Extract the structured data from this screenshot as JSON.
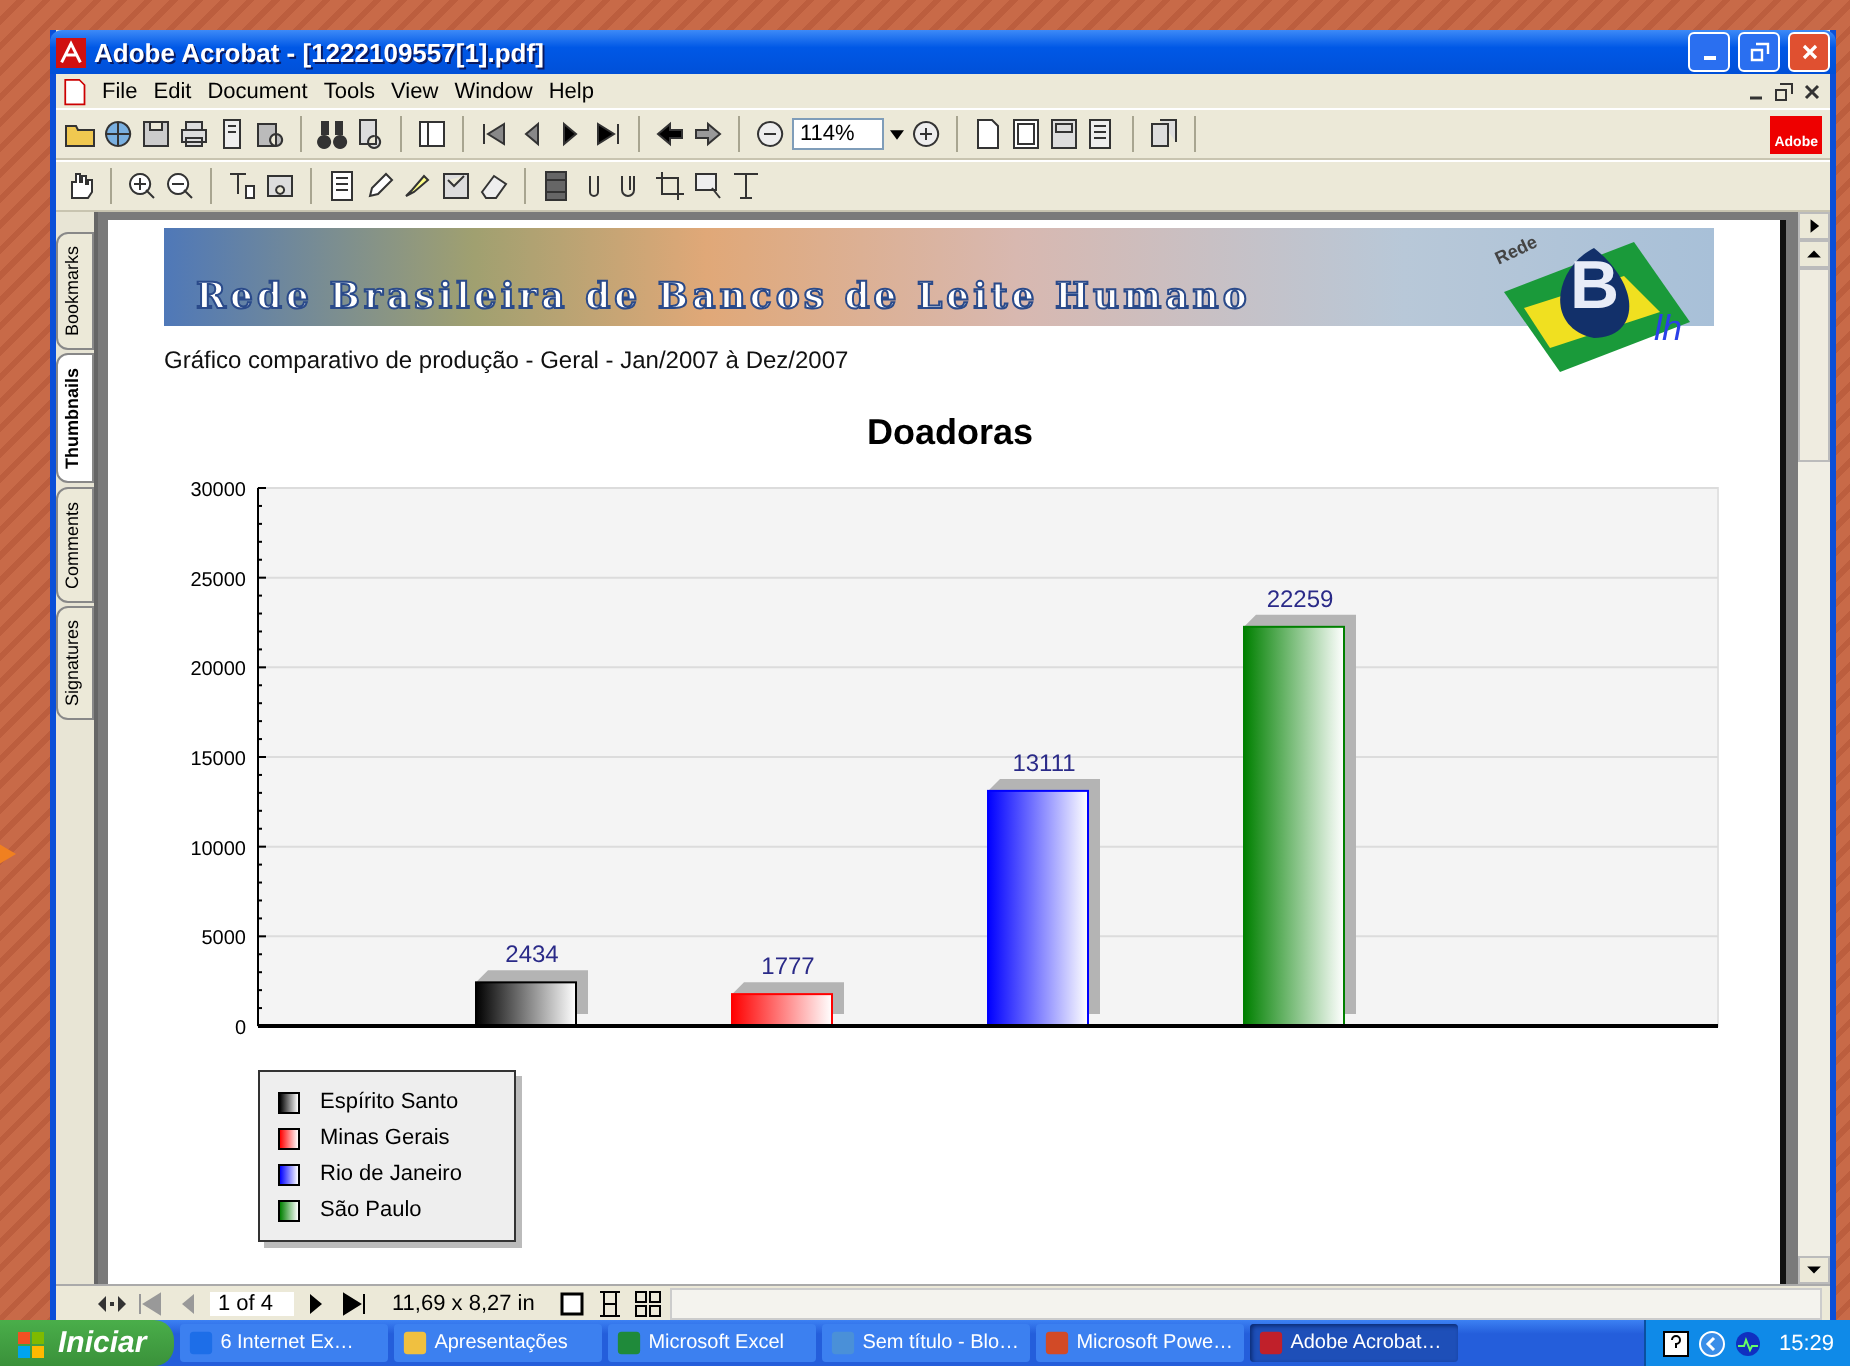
{
  "window": {
    "title": "Adobe Acrobat - [1222109557[1].pdf]"
  },
  "menu": [
    "File",
    "Edit",
    "Document",
    "Tools",
    "View",
    "Window",
    "Help"
  ],
  "toolbar": {
    "zoom": "114%",
    "logo": "Adobe"
  },
  "side_tabs": [
    {
      "label": "Bookmarks",
      "selected": false
    },
    {
      "label": "Thumbnails",
      "selected": true
    },
    {
      "label": "Comments",
      "selected": false
    },
    {
      "label": "Signatures",
      "selected": false
    }
  ],
  "document": {
    "banner": "Rede Brasileira de Bancos de Leite Humano",
    "logo_text": "Rede",
    "logo_letters": "B",
    "logo_sub": "lh",
    "subtitle": "Gráfico comparativo de produção - Geral - Jan/2007 à Dez/2007",
    "chart_data": {
      "type": "bar",
      "title": "Doadoras",
      "ylim": [
        0,
        30000
      ],
      "yticks": [
        0,
        5000,
        10000,
        15000,
        20000,
        25000,
        30000
      ],
      "data_labels": true,
      "grid": true,
      "series": [
        {
          "name": "Espírito Santo",
          "color": "#000000",
          "values": [
            2434
          ]
        },
        {
          "name": "Minas Gerais",
          "color": "#ff0000",
          "values": [
            1777
          ]
        },
        {
          "name": "Rio de Janeiro",
          "color": "#0000ff",
          "values": [
            13111
          ]
        },
        {
          "name": "São Paulo",
          "color": "#008000",
          "values": [
            22259
          ]
        }
      ]
    }
  },
  "status_bar": {
    "page": "1 of 4",
    "size": "11,69 x 8,27 in"
  },
  "taskbar": {
    "start": "Iniciar",
    "tasks": [
      {
        "label": "6 Internet Ex…",
        "selected": false
      },
      {
        "label": "Apresentações",
        "selected": false
      },
      {
        "label": "Microsoft Excel",
        "selected": false
      },
      {
        "label": "Sem título - Blo…",
        "selected": false
      },
      {
        "label": "Microsoft Powe…",
        "selected": false
      },
      {
        "label": "Adobe Acrobat…",
        "selected": true
      }
    ],
    "clock": "15:29"
  }
}
